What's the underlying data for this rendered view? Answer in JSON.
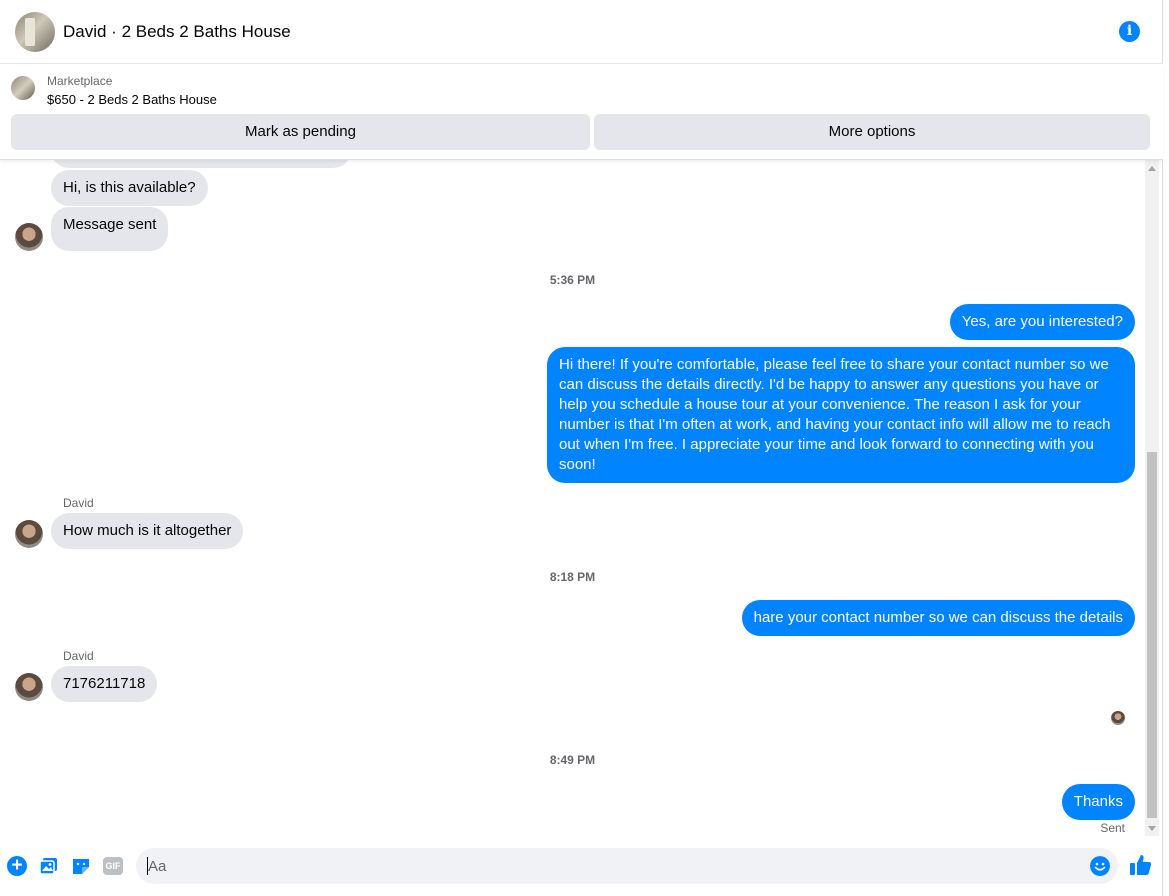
{
  "header": {
    "title": "David · 2 Beds 2 Baths House",
    "info_icon": "info-icon"
  },
  "marketplace": {
    "label": "Marketplace",
    "listing": "$650 - 2 Beds 2 Baths House",
    "pending_button": "Mark as pending",
    "more_button": "More options"
  },
  "messages": {
    "m1": "Hi, is this available?",
    "m2": "Message sent",
    "time1": "5:36 PM",
    "m3": "Yes, are you interested?",
    "m4": "Hi there! If you're comfortable, please feel free to share your contact number so we can discuss the details directly. I'd be happy to answer any questions you have or help you schedule a house tour at your convenience. The reason I ask for your number is that I'm often at work, and having your contact info will allow me to reach out when I'm free. I appreciate your time and look forward to connecting with you soon!",
    "sender1": "David",
    "m5": "How much is it altogether",
    "time2": "8:18 PM",
    "m6": "hare your contact number so we can discuss the details",
    "sender2": "David",
    "m7": "7176211718",
    "time3": "8:49 PM",
    "m8": "Thanks",
    "status": "Sent"
  },
  "composer": {
    "placeholder": "Aa",
    "icons": [
      "plus-icon",
      "photo-icon",
      "sticker-icon",
      "gif-icon",
      "emoji-icon",
      "like-icon"
    ],
    "gif_label": "GIF"
  },
  "colors": {
    "accent": "#0084ff",
    "incoming_bubble": "#e4e6eb",
    "secondary_text": "#65676b"
  }
}
